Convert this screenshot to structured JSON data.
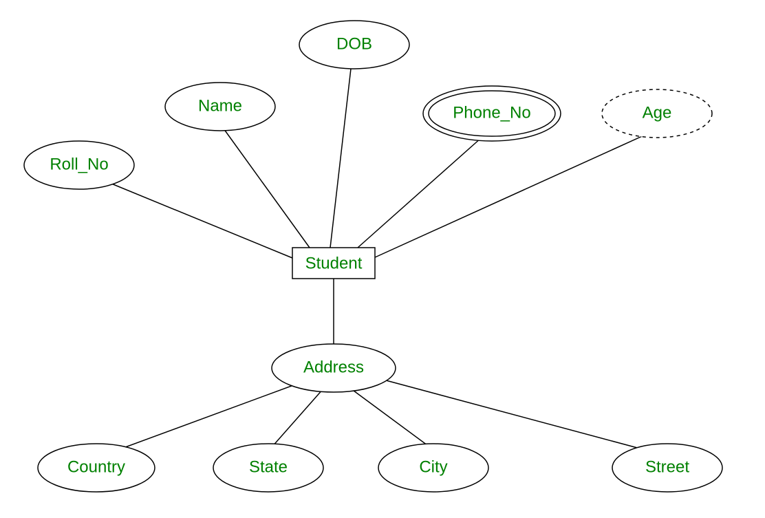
{
  "diagram": {
    "entity": {
      "label": "Student"
    },
    "attributes": {
      "roll_no": {
        "label": "Roll_No"
      },
      "name": {
        "label": "Name"
      },
      "dob": {
        "label": "DOB"
      },
      "phone": {
        "label": "Phone_No"
      },
      "age": {
        "label": "Age"
      },
      "address": {
        "label": "Address"
      },
      "country": {
        "label": "Country"
      },
      "state": {
        "label": "State"
      },
      "city": {
        "label": "City"
      },
      "street": {
        "label": "Street"
      }
    }
  }
}
